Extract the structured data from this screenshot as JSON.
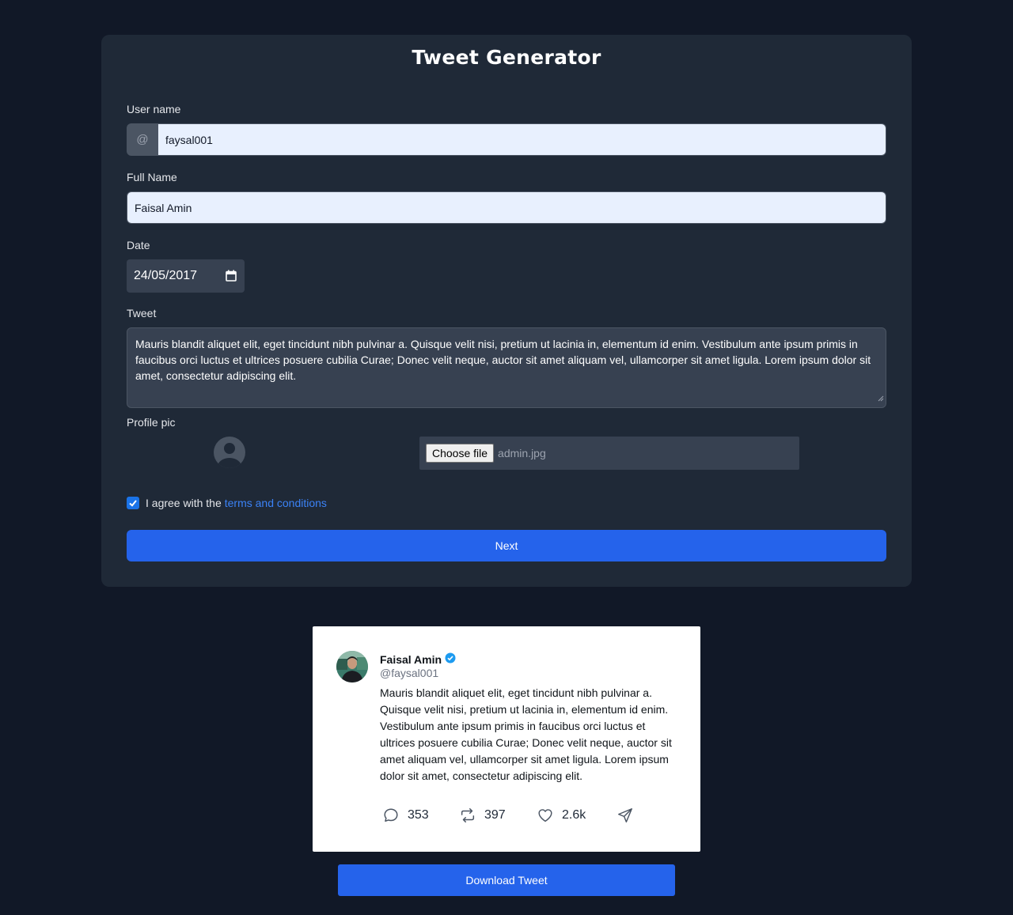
{
  "form": {
    "title": "Tweet Generator",
    "username_label": "User name",
    "username_prefix": "@",
    "username_value": "faysal001",
    "fullname_label": "Full Name",
    "fullname_value": "Faisal Amin",
    "date_label": "Date",
    "date_value": "24/05/2017",
    "tweet_label": "Tweet",
    "tweet_value": "Mauris blandit aliquet elit, eget tincidunt nibh pulvinar a. Quisque velit nisi, pretium ut lacinia in, elementum id enim. Vestibulum ante ipsum primis in faucibus orci luctus et ultrices posuere cubilia Curae; Donec velit neque, auctor sit amet aliquam vel, ullamcorper sit amet ligula. Lorem ipsum dolor sit amet, consectetur adipiscing elit.",
    "profile_pic_label": "Profile pic",
    "file_button": "Choose file",
    "file_name": "admin.jpg",
    "agree_checked": true,
    "agree_text": "I agree with the",
    "agree_link": "terms and conditions",
    "next_button": "Next"
  },
  "tweet": {
    "name": "Faisal Amin",
    "handle": "@faysal001",
    "verified": true,
    "text": "Mauris blandit aliquet elit, eget tincidunt nibh pulvinar a. Quisque velit nisi, pretium ut lacinia in, elementum id enim. Vestibulum ante ipsum primis in faucibus orci luctus et ultrices posuere cubilia Curae; Donec velit neque, auctor sit amet aliquam vel, ullamcorper sit amet ligula. Lorem ipsum dolor sit amet, consectetur adipiscing elit.",
    "replies": "353",
    "retweets": "397",
    "likes": "2.6k"
  },
  "download_button": "Download Tweet",
  "icons": {
    "reply": "comment-icon",
    "retweet": "retweet-icon",
    "like": "heart-icon",
    "share": "send-icon",
    "verified": "verified-badge-icon",
    "calendar": "calendar-icon"
  },
  "colors": {
    "page_bg": "#111827",
    "panel_bg": "#1f2937",
    "accent": "#2563eb",
    "verified": "#1d9bf0"
  }
}
